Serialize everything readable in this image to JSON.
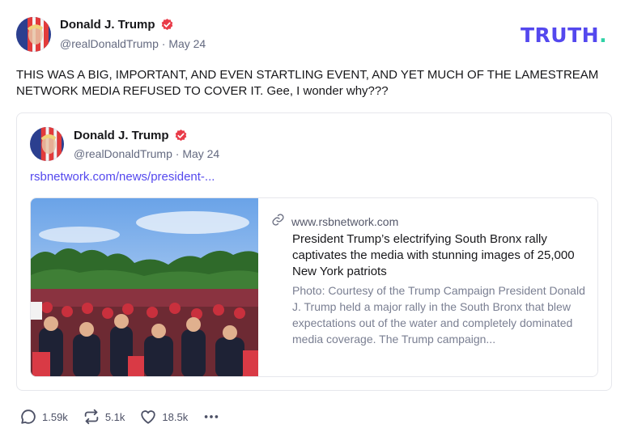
{
  "post": {
    "author": {
      "name": "Donald J. Trump",
      "handle": "@realDonaldTrump",
      "separator": "·",
      "date": "May 24"
    },
    "text": "THIS WAS A BIG, IMPORTANT, AND EVEN STARTLING EVENT, AND YET MUCH OF THE LAMESTREAM NETWORK MEDIA REFUSED TO COVER IT. Gee, I wonder why???",
    "counts": {
      "replies": "1.59k",
      "retruths": "5.1k",
      "likes": "18.5k"
    }
  },
  "brand": {
    "logo_text": "TRUTH",
    "logo_dot": ".",
    "primary_color": "#5448ee",
    "dot_color": "#2fd2a6",
    "verified_color": "#e93b48"
  },
  "quoted_post": {
    "author": {
      "name": "Donald J. Trump",
      "handle": "@realDonaldTrump",
      "separator": "·",
      "date": "May 24"
    },
    "link": "rsbnetwork.com/news/president-...",
    "card": {
      "domain": "www.rsbnetwork.com",
      "title": "President Trump’s electrifying South Bronx rally captivates the media with stunning images of 25,000 New York patriots",
      "description": "Photo: Courtesy of the Trump Campaign President Donald J. Trump held a major rally in the South Bronx that blew expectations out of the water and completely dominated media coverage. The Trump campaign..."
    }
  },
  "icons": {
    "verified": "verified-check-icon",
    "link": "link-icon",
    "reply": "reply-bubble-icon",
    "retruth": "retruth-icon",
    "like": "heart-icon",
    "more": "more-dots-icon"
  }
}
